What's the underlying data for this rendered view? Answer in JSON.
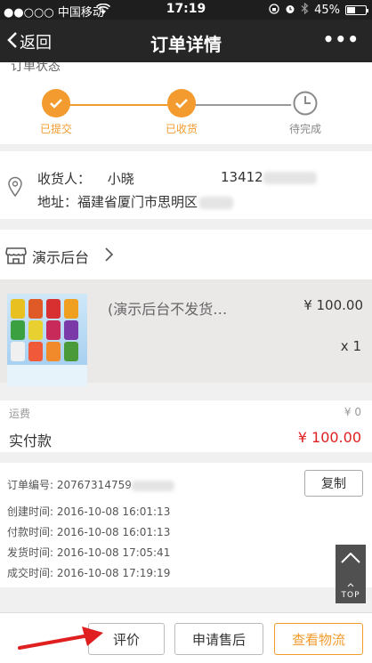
{
  "status_bar": {
    "carrier": "●●○○○ 中国移动",
    "time": "17:19",
    "battery": "45%",
    "battery_level": 0.45
  },
  "navbar": {
    "back_label": "返回",
    "title": "订单详情",
    "more_label": "•••"
  },
  "order_status": {
    "title": "订单状态",
    "steps": [
      {
        "label": "已提交",
        "state": "done"
      },
      {
        "label": "已收货",
        "state": "done"
      },
      {
        "label": "待完成",
        "state": "pending"
      }
    ]
  },
  "address": {
    "receiver_label": "收货人：",
    "receiver_name": "小晓",
    "phone": "13412",
    "address_label": "地址：",
    "address": "福建省厦门市思明区"
  },
  "shop": {
    "name": "演示后台"
  },
  "product": {
    "name": "(演示后台不发货…",
    "price": "¥ 100.00",
    "quantity": "x 1"
  },
  "fees": {
    "shipping_label": "运费",
    "shipping_value": "¥ 0",
    "paid_label": "实付款",
    "paid_value": "¥ 100.00"
  },
  "order_info": {
    "order_no_label": "订单编号:",
    "order_no": "20767314759",
    "copy_label": "复制",
    "rows": [
      {
        "label": "创建时间:",
        "value": "2016-10-08 16:01:13"
      },
      {
        "label": "付款时间:",
        "value": "2016-10-08 16:01:13"
      },
      {
        "label": "发货时间:",
        "value": "2016-10-08 17:05:41"
      },
      {
        "label": "成交时间:",
        "value": "2016-10-08 17:19:19"
      }
    ]
  },
  "top_button": {
    "label": "TOP"
  },
  "actions": {
    "review_label": "评价",
    "after_sale_label": "申请售后",
    "logistics_label": "查看物流"
  },
  "colors": {
    "accent": "#f39b2e",
    "price_red": "#e02020",
    "pending": "#8a8a8a"
  }
}
